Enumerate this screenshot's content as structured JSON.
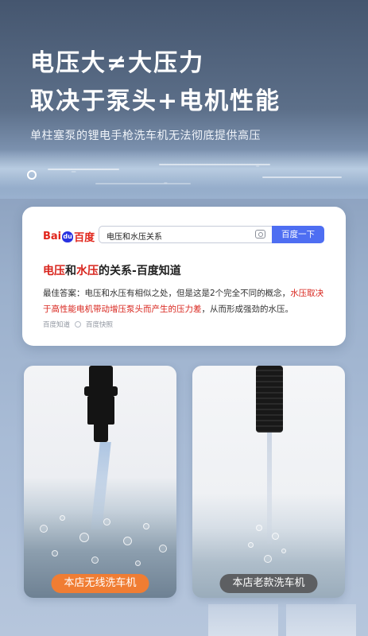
{
  "headline": {
    "line1": "电压大≠大压力",
    "line2": "取决于泵头+电机性能",
    "subline": "单柱塞泵的锂电手枪洗车机无法彻底提供高压"
  },
  "search_card": {
    "logo": {
      "part1": "Bai",
      "paw": "du",
      "part2": "百度"
    },
    "query": "电压和水压关系",
    "button_label": "百度一下",
    "result_title": {
      "red1": "电压",
      "mid1": "和",
      "red2": "水压",
      "rest": "的关系-百度知道"
    },
    "answer": {
      "prefix": "最佳答案：电压和水压有相似之处，但是这是2个完全不同的概念，",
      "highlight": "水压取决于高性能电机带动增压泵头而产生的压力差",
      "suffix": "，从而形成强劲的水压。"
    },
    "source_name": "百度知道",
    "source_snapshot": "百度快照"
  },
  "comparison": {
    "left_label": "本店无线洗车机",
    "right_label": "本店老款洗车机"
  },
  "colors": {
    "accent_orange": "#f07d33",
    "baidu_blue": "#4e6ef2",
    "baidu_red": "#d8241c",
    "label_gray": "#5d5f62"
  },
  "icons": {
    "camera": "camera-icon",
    "source_dot": "dot-icon",
    "ring": "ring-icon"
  }
}
